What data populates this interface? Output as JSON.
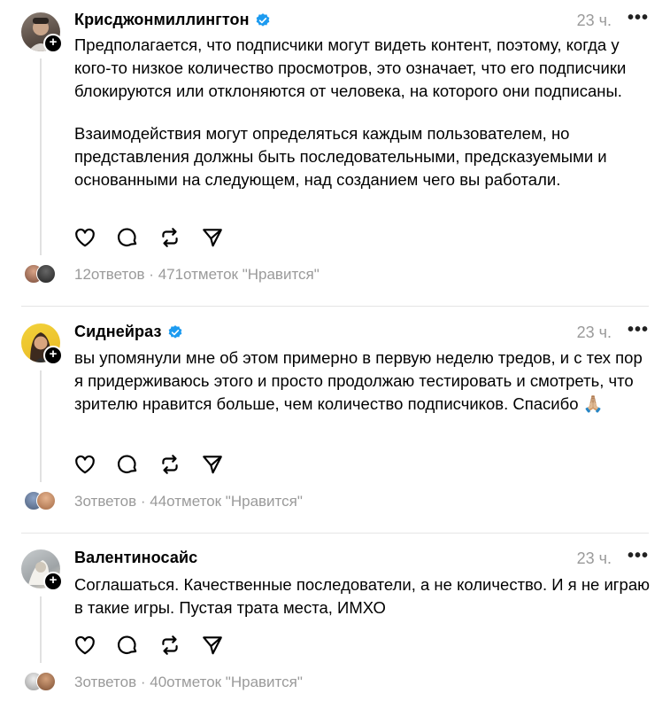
{
  "posts": [
    {
      "username": "Крисджонмиллингтон",
      "verified": true,
      "time": "23 ч.",
      "paragraphs": [
        "Предполагается, что подписчики могут видеть контент, поэтому, когда у кого-то низкое количество просмотров, это означает, что его подписчики блокируются или отклоняются от человека, на которого они подписаны.",
        "Взаимодействия могут определяться каждым пользователем, но представления должны быть последовательными, предсказуемыми и основанными на следующем, над созданием чего вы работали."
      ],
      "stats": "12ответов · 471отметок \"Нравится\""
    },
    {
      "username": "Сиднейраз",
      "verified": true,
      "time": "23 ч.",
      "paragraphs": [
        "вы упомянули мне об этом примерно в первую неделю тредов, и с тех пор я придерживаюсь этого и просто продолжаю тестировать и смотреть, что зрителю нравится больше, чем количество подписчиков. Спасибо 🙏🏼"
      ],
      "stats": "3ответов · 44отметок \"Нравится\""
    },
    {
      "username": "Валентиносайс",
      "verified": false,
      "time": "23 ч.",
      "paragraphs": [
        "Соглашаться. Качественные последователи, а не количество. И я не играю в такие игры. Пустая трата места, ИМХО"
      ],
      "stats": "3ответов · 40отметок \"Нравится\""
    }
  ],
  "icons": {
    "more": "more-icon",
    "like": "heart-icon",
    "reply": "comment-icon",
    "repost": "repost-icon",
    "share": "send-icon",
    "verified": "verified-badge-icon",
    "follow": "plus-icon"
  },
  "colors": {
    "verified": "#1d9bf0",
    "muted": "#9a9a9a",
    "divider": "#e5e5e5"
  }
}
